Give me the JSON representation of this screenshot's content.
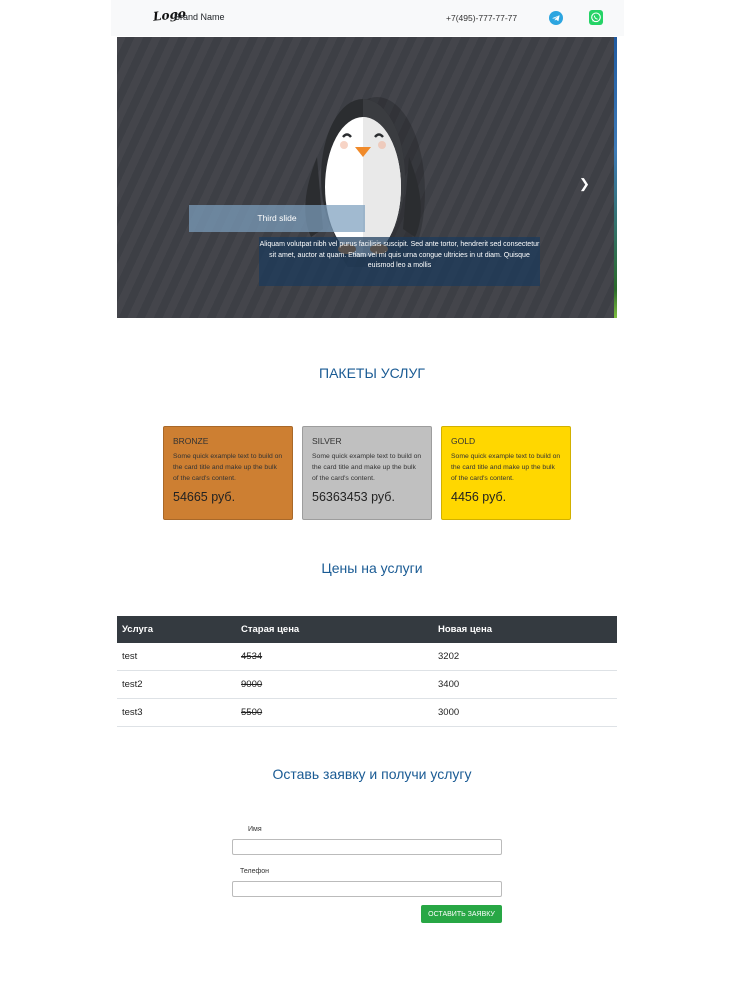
{
  "navbar": {
    "logo_text": "Logo",
    "brand_name": "Brand Name",
    "phone": "+7(495)-777-77-77",
    "icons": [
      "telegram-icon",
      "whatsapp-icon"
    ],
    "background": "#f8f9fa"
  },
  "carousel": {
    "slide_title": "Third slide",
    "slide_text": "Aliquam volutpat nibh vel purus facilisis suscipit. Sed ante tortor, hendrerit sed consectetur sit amet, auctor at quam. Etiam vel mi quis urna congue ultricies in ut diam. Quisque euismod leo a mollis",
    "next_icon": "chevron-right-icon"
  },
  "packages": {
    "heading": "ПАКЕТЫ УСЛУГ",
    "cards": [
      {
        "title": "BRONZE",
        "text": "Some quick example text to build on the card title and make up the bulk of the card's content.",
        "price": "54665 руб.",
        "color": "#cd7f32"
      },
      {
        "title": "SILVER",
        "text": "Some quick example text to build on the card title and make up the bulk of the card's content.",
        "price": "56363453 руб.",
        "color": "#c0c0c0"
      },
      {
        "title": "GOLD",
        "text": "Some quick example text to build on the card title and make up the bulk of the card's content.",
        "price": "4456 руб.",
        "color": "#ffd700"
      }
    ]
  },
  "prices": {
    "heading": "Цены на услуги",
    "columns": [
      "Услуга",
      "Старая цена",
      "Новая цена"
    ],
    "rows": [
      {
        "service": "test",
        "old_price": "4534",
        "new_price": "3202"
      },
      {
        "service": "test2",
        "old_price": "9000",
        "new_price": "3400"
      },
      {
        "service": "test3",
        "old_price": "5500",
        "new_price": "3000"
      }
    ]
  },
  "form": {
    "heading": "Оставь заявку и получи услугу",
    "name_label": "Имя",
    "name_value": "",
    "phone_label": "Телефон",
    "phone_value": "",
    "submit_label": "ОСТАВИТЬ ЗАЯВКУ",
    "submit_color": "#28a745"
  }
}
